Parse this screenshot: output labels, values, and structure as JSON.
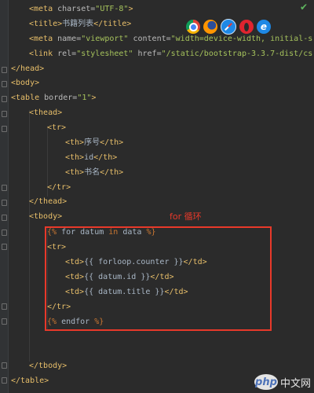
{
  "lines": {
    "l1": {
      "a": "<meta ",
      "b": "charset=",
      "c": "\"UTF-8\"",
      "d": ">"
    },
    "l2": {
      "a": "<title>",
      "b": "书籍列表",
      "c": "</title>"
    },
    "l3": {
      "a": "<meta ",
      "b": "name=",
      "c": "\"viewport\" ",
      "d": "content=",
      "e": "\"width=device-width, initial-s"
    },
    "l4": {
      "a": "<link ",
      "b": "rel=",
      "c": "\"stylesheet\" ",
      "d": "href=",
      "e": "\"/static/bootstrap-3.3.7-dist/cs"
    },
    "l5": {
      "a": "</head>"
    },
    "l6": {
      "a": "<body>"
    },
    "l7": {
      "a": "<table ",
      "b": "border=",
      "c": "\"1\"",
      "d": ">"
    },
    "l8": {
      "a": "<thead>"
    },
    "l9": {
      "a": "<tr>"
    },
    "l10": {
      "a": "<th>",
      "b": "序号",
      "c": "</th>"
    },
    "l11": {
      "a": "<th>",
      "b": "id",
      "c": "</th>"
    },
    "l12": {
      "a": "<th>",
      "b": "书名",
      "c": "</th>"
    },
    "l13": {
      "a": "</tr>"
    },
    "l14": {
      "a": "</thead>"
    },
    "l15": {
      "a": "<tbody>"
    },
    "l16": {
      "a": "{% ",
      "b": "for datum ",
      "c": "in ",
      "d": "data ",
      "e": "%}"
    },
    "l17": {
      "a": "<tr>"
    },
    "l18": {
      "a": "<td>",
      "b": "{{ forloop.counter }}",
      "c": "</td>"
    },
    "l19": {
      "a": "<td>",
      "b": "{{ datum.id }}",
      "c": "</td>"
    },
    "l20": {
      "a": "<td>",
      "b": "{{ datum.title }}",
      "c": "</td>"
    },
    "l21": {
      "a": "</tr>"
    },
    "l22": {
      "a": "{% ",
      "b": "endfor ",
      "c": "%}"
    },
    "l23": {
      "a": "</tbody>"
    },
    "l24": {
      "a": "</table>"
    }
  },
  "annotation": "for 循环",
  "browsers": {
    "chrome": "chrome-icon",
    "firefox": "firefox-icon",
    "safari": "safari-icon",
    "opera": "opera-icon",
    "ie": "ie-icon"
  },
  "watermark": {
    "logo": "php",
    "text": "中文网"
  },
  "colors": {
    "highlight": "#e8392a",
    "background": "#2b2b2b",
    "tag": "#e8bf6a",
    "string": "#a5c25c"
  }
}
